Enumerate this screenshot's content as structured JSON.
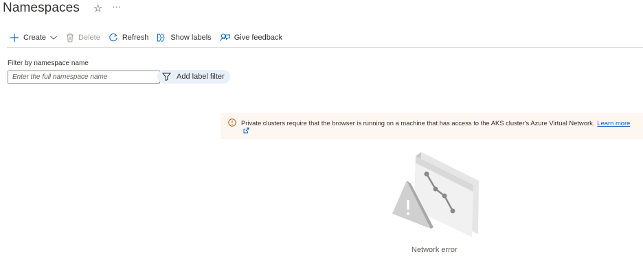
{
  "header": {
    "title": "Namespaces",
    "star_icon": "star-icon",
    "more_icon": "more-icon",
    "more_text": "···"
  },
  "toolbar": {
    "create_label": "Create",
    "delete_label": "Delete",
    "refresh_label": "Refresh",
    "show_labels_label": "Show labels",
    "give_feedback_label": "Give feedback"
  },
  "filter": {
    "label": "Filter by namespace name",
    "placeholder": "Enter the full namespace name",
    "value": "",
    "add_label_filter": "Add label filter"
  },
  "banner": {
    "text": "Private clusters require that the browser is running on a machine that has access to the AKS cluster's Azure Virtual Network.",
    "link_text": "Learn more",
    "background": "#fdf6f1",
    "icon_color": "#c25a00"
  },
  "empty_state": {
    "message": "Network error"
  },
  "colors": {
    "accent": "#0f6cbd",
    "link": "#0f5bb8"
  }
}
